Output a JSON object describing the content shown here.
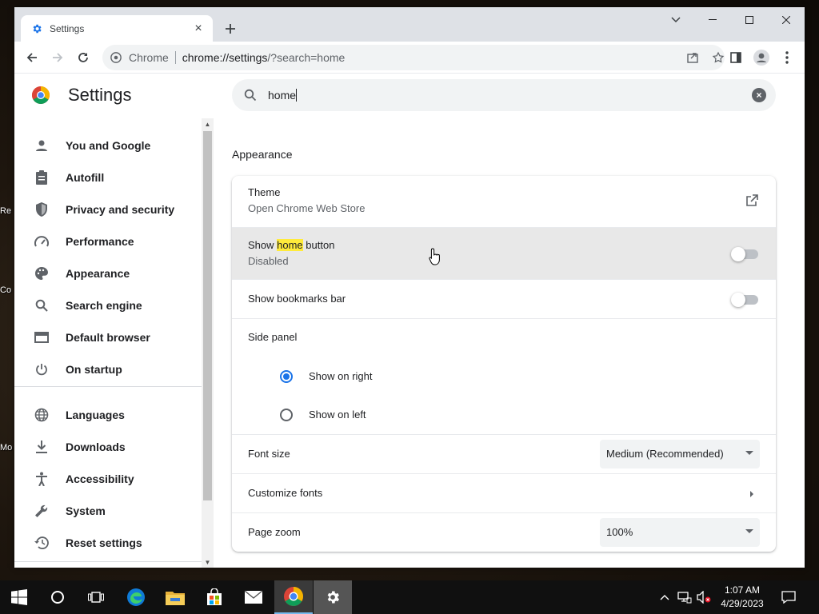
{
  "desktop": {
    "labels": [
      "Re",
      "Co",
      "Mo"
    ]
  },
  "browser": {
    "tab_title": "Settings",
    "omnibox_label": "Chrome",
    "url_host": "chrome://settings",
    "url_path": "/?search=home"
  },
  "settings": {
    "title": "Settings",
    "search_value": "home",
    "sidebar": [
      {
        "label": "You and Google",
        "icon": "person-icon"
      },
      {
        "label": "Autofill",
        "icon": "clipboard-icon"
      },
      {
        "label": "Privacy and security",
        "icon": "shield-icon"
      },
      {
        "label": "Performance",
        "icon": "speedometer-icon"
      },
      {
        "label": "Appearance",
        "icon": "palette-icon"
      },
      {
        "label": "Search engine",
        "icon": "search-icon"
      },
      {
        "label": "Default browser",
        "icon": "browser-icon"
      },
      {
        "label": "On startup",
        "icon": "power-icon"
      },
      {
        "label": "Languages",
        "icon": "globe-icon"
      },
      {
        "label": "Downloads",
        "icon": "download-icon"
      },
      {
        "label": "Accessibility",
        "icon": "accessibility-icon"
      },
      {
        "label": "System",
        "icon": "wrench-icon"
      },
      {
        "label": "Reset settings",
        "icon": "history-icon"
      }
    ],
    "section_title": "Appearance",
    "theme": {
      "title": "Theme",
      "subtitle": "Open Chrome Web Store"
    },
    "home_button": {
      "title_before": "Show ",
      "title_highlight": "home",
      "title_after": " button",
      "subtitle": "Disabled",
      "enabled": false
    },
    "bookmarks_bar": {
      "title": "Show bookmarks bar",
      "enabled": false
    },
    "side_panel": {
      "title": "Side panel",
      "options": [
        "Show on right",
        "Show on left"
      ],
      "selected": "Show on right"
    },
    "font_size": {
      "label": "Font size",
      "value": "Medium (Recommended)"
    },
    "customize_fonts": {
      "label": "Customize fonts"
    },
    "page_zoom": {
      "label": "Page zoom",
      "value": "100%"
    }
  },
  "taskbar": {
    "time": "1:07 AM",
    "date": "4/29/2023"
  },
  "colors": {
    "accent": "#1a73e8",
    "highlight": "#ffeb3b"
  }
}
